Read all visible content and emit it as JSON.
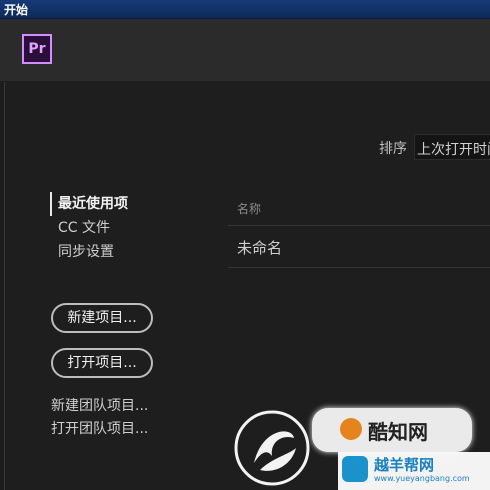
{
  "window": {
    "title": "开始"
  },
  "header": {
    "logo_text": "Pr",
    "logo_color": "#d58cff"
  },
  "sort": {
    "label": "排序",
    "value": "上次打开时间"
  },
  "nav": {
    "items": [
      {
        "label": "最近使用项",
        "active": true
      },
      {
        "label": "CC 文件",
        "active": false
      },
      {
        "label": "同步设置",
        "active": false
      }
    ]
  },
  "buttons": {
    "new_project": "新建项目...",
    "open_project": "打开项目..."
  },
  "links": {
    "new_team_project": "新建团队项目...",
    "open_team_project": "打开团队项目..."
  },
  "files": {
    "column_name": "名称",
    "rows": [
      {
        "name": "未命名"
      }
    ]
  },
  "watermark": {
    "brand_text": "酷知网",
    "site_text": "越羊帮网",
    "site_url": "www.yueyangbang.com"
  }
}
